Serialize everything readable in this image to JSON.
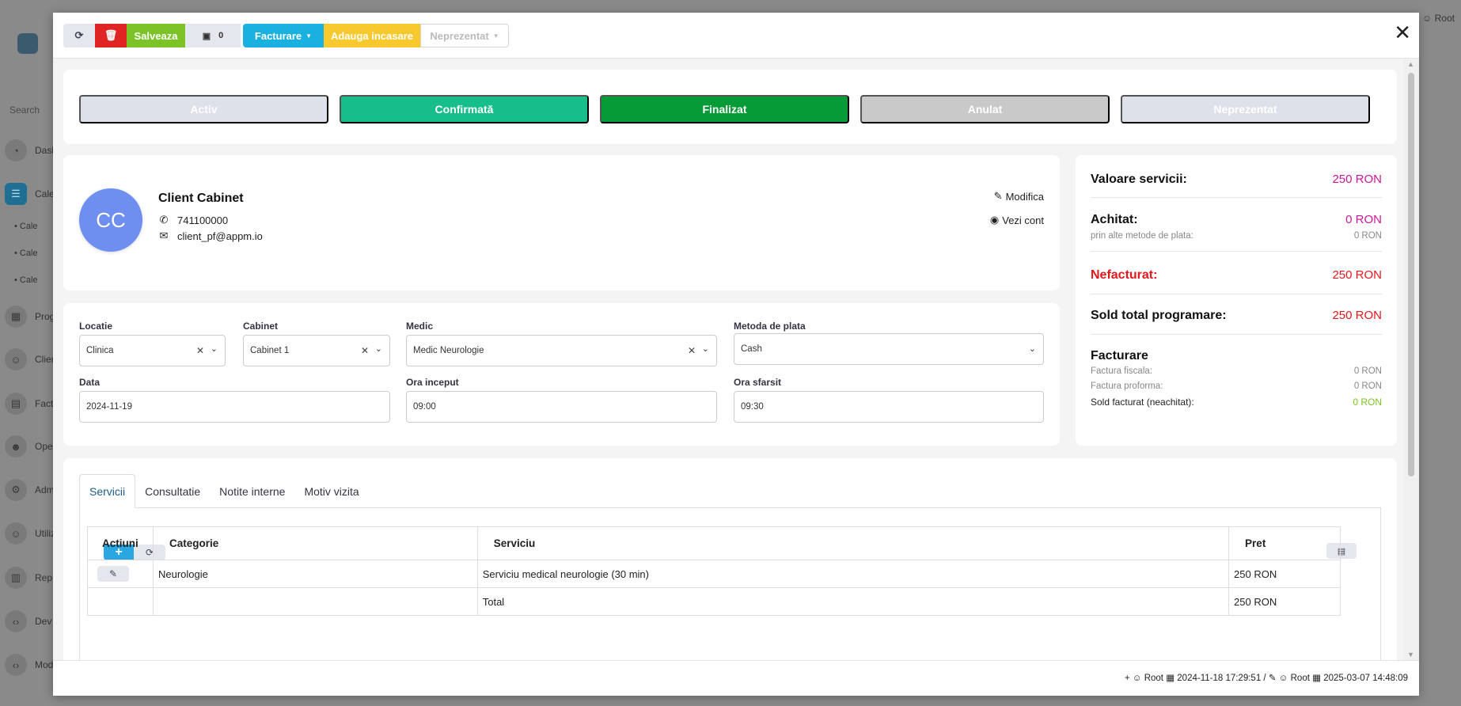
{
  "background": {
    "search_placeholder": "Search",
    "nav": [
      {
        "label": "Dash",
        "icon": "dashboard-icon"
      },
      {
        "label": "Cale",
        "icon": "calendar-list-icon"
      },
      {
        "label": "Prog",
        "icon": "calendar-icon"
      },
      {
        "label": "Clien",
        "icon": "clients-icon"
      },
      {
        "label": "Fact",
        "icon": "invoice-icon"
      },
      {
        "label": "Ope",
        "icon": "operators-icon"
      },
      {
        "label": "Adm",
        "icon": "settings-icon"
      },
      {
        "label": "Utiliz",
        "icon": "users-icon"
      },
      {
        "label": "Rep",
        "icon": "reports-icon"
      },
      {
        "label": "Dev",
        "icon": "code-icon"
      },
      {
        "label": "Mod",
        "icon": "modules-icon"
      }
    ],
    "subnav": [
      "Cale",
      "Cale",
      "Cale"
    ],
    "user": "Root"
  },
  "toolbar": {
    "save_label": "Salveaza",
    "images_count": "0",
    "facturare_label": "Facturare",
    "incasare_label": "Adauga incasare",
    "neprezentat_label": "Neprezentat"
  },
  "status_buttons": [
    {
      "label": "Activ"
    },
    {
      "label": "Confirmată"
    },
    {
      "label": "Finalizat"
    },
    {
      "label": "Anulat"
    },
    {
      "label": "Neprezentat"
    }
  ],
  "client": {
    "initials": "CC",
    "name": "Client Cabinet",
    "phone": "741100000",
    "email": "client_pf@appm.io",
    "edit_label": "Modifica",
    "view_account_label": "Vezi cont"
  },
  "summary": {
    "valoare_label": "Valoare servicii:",
    "valoare_value": "250 RON",
    "achitat_label": "Achitat:",
    "achitat_value": "0 RON",
    "alte_metode_label": "prin alte metode de plata:",
    "alte_metode_value": "0 RON",
    "nefacturat_label": "Nefacturat:",
    "nefacturat_value": "250 RON",
    "sold_label": "Sold total programare:",
    "sold_value": "250 RON",
    "facturare_title": "Facturare",
    "factura_fiscala_label": "Factura fiscala:",
    "factura_fiscala_value": "0 RON",
    "factura_proforma_label": "Factura proforma:",
    "factura_proforma_value": "0 RON",
    "sold_facturat_label": "Sold facturat (neachitat):",
    "sold_facturat_value": "0 RON",
    "colors": {
      "magenta": "#c8189b",
      "red": "#e0181e",
      "green": "#7bc326"
    }
  },
  "form": {
    "locatie_label": "Locatie",
    "locatie_value": "Clinica",
    "cabinet_label": "Cabinet",
    "cabinet_value": "Cabinet 1",
    "medic_label": "Medic",
    "medic_value": "Medic Neurologie",
    "metoda_label": "Metoda de plata",
    "metoda_value": "Cash",
    "data_label": "Data",
    "data_value": "2024-11-19",
    "ora_inceput_label": "Ora inceput",
    "ora_inceput_value": "09:00",
    "ora_sfarsit_label": "Ora sfarsit",
    "ora_sfarsit_value": "09:30"
  },
  "tabs": [
    "Servicii",
    "Consultatie",
    "Notite interne",
    "Motiv vizita"
  ],
  "services_table": {
    "headers": [
      "Actiuni",
      "Categorie",
      "Serviciu",
      "Pret"
    ],
    "rows": [
      {
        "categorie": "Neurologie",
        "serviciu": "Serviciu medical neurologie (30 min)",
        "pret": "250 RON"
      }
    ],
    "total_label": "Total",
    "total_value": "250 RON"
  },
  "footer": {
    "created_by": "Root",
    "created_at": "2024-11-18 17:29:51",
    "separator": "/",
    "modified_by": "Root",
    "modified_at": "2025-03-07 14:48:09"
  }
}
